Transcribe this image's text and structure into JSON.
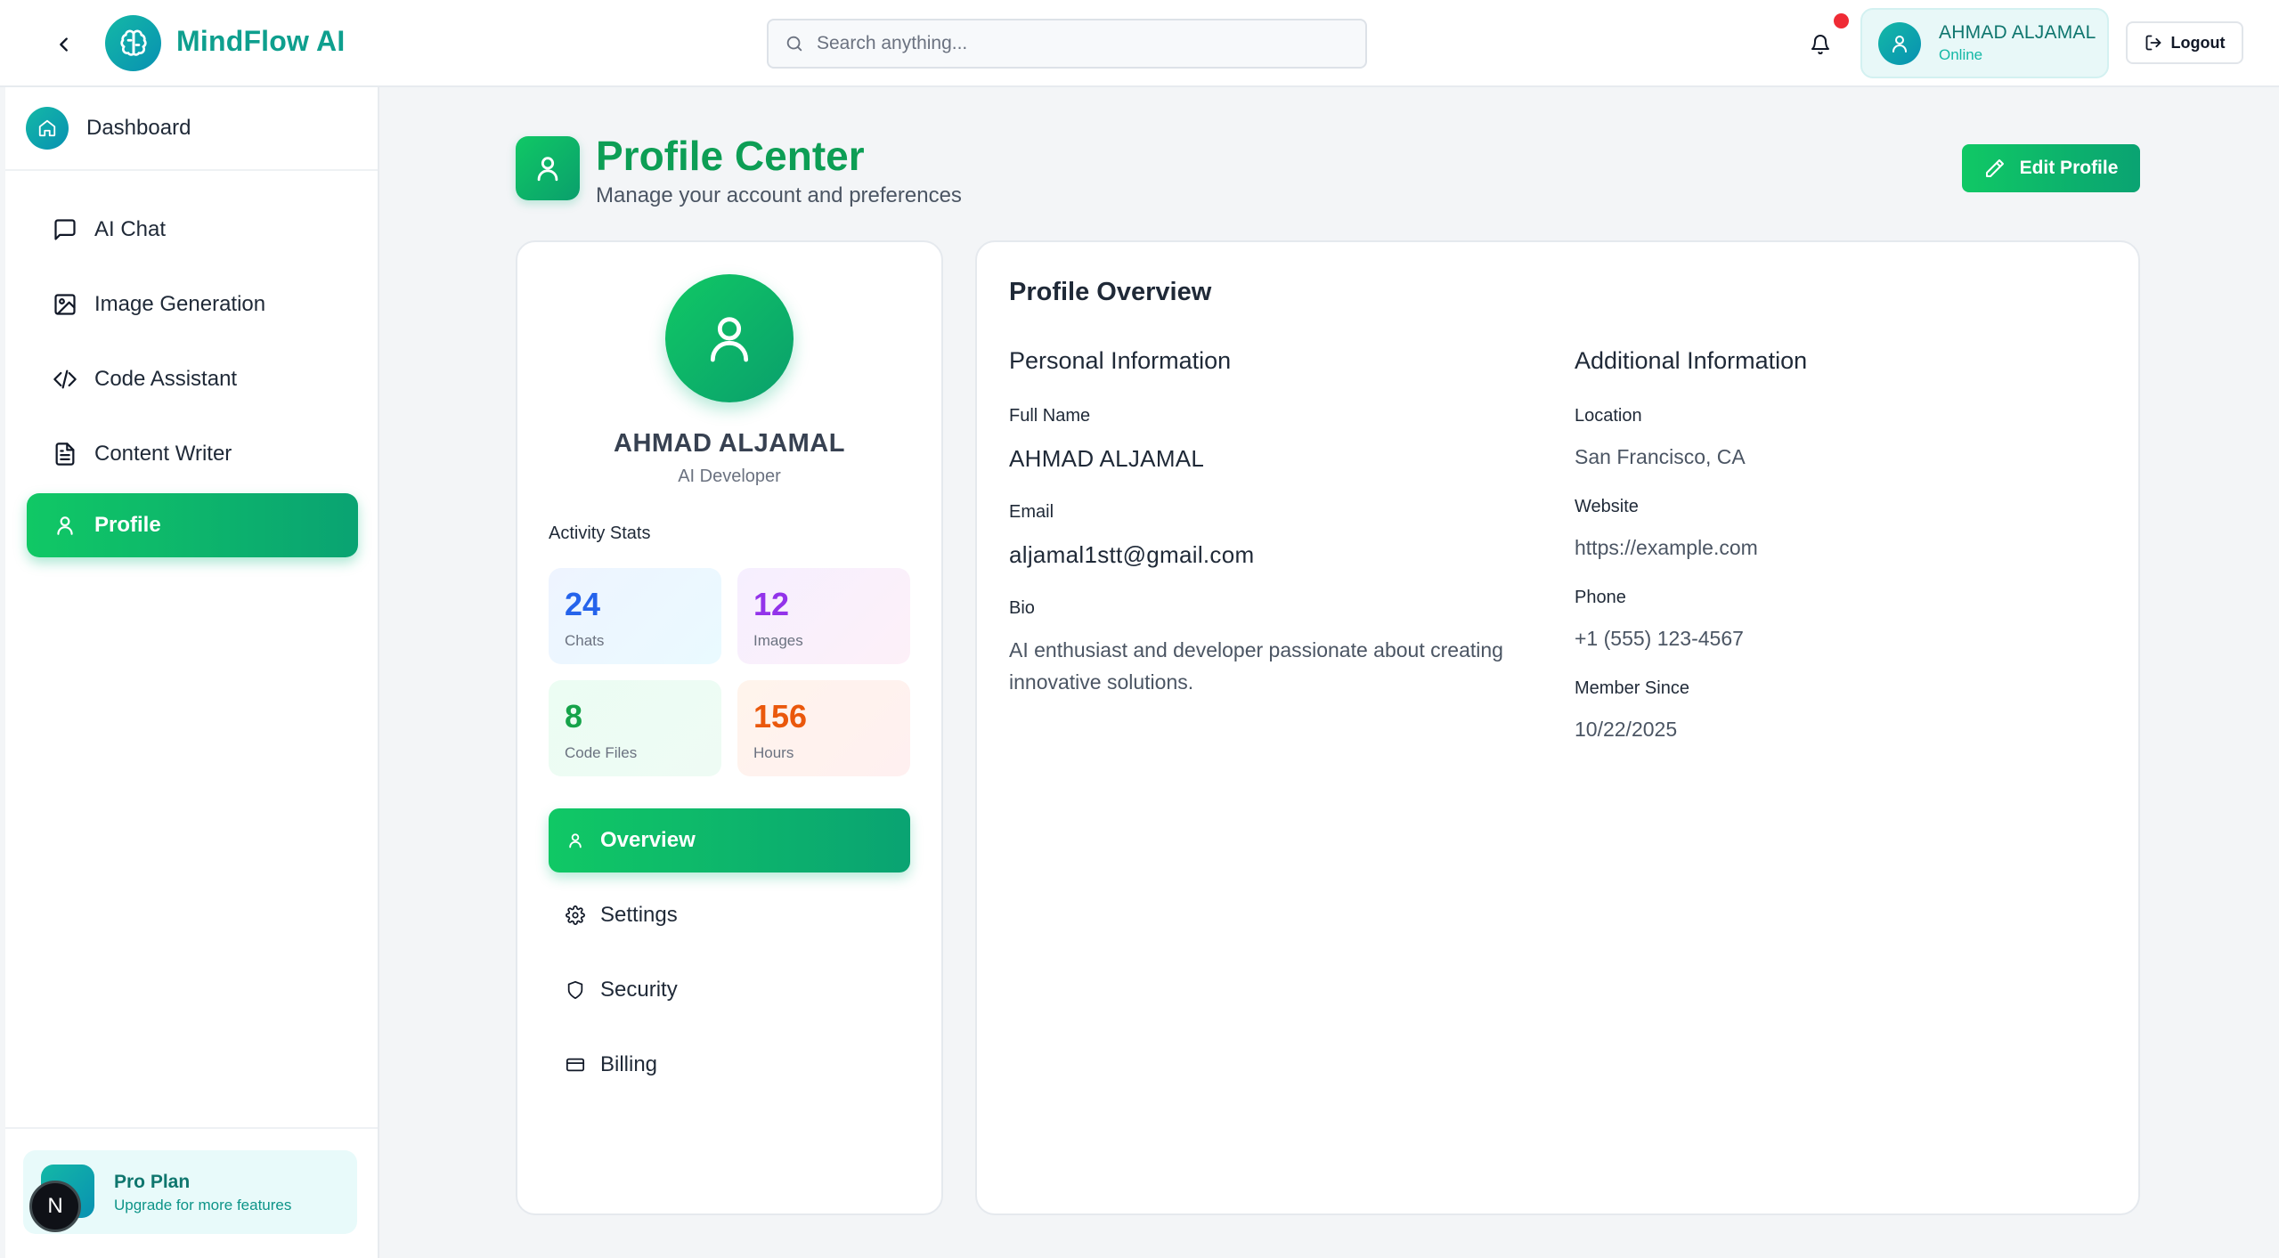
{
  "header": {
    "brand": "MindFlow AI",
    "search_placeholder": "Search anything...",
    "user": {
      "name": "AHMAD ALJAMAL",
      "status": "Online"
    },
    "logout_label": "Logout"
  },
  "sidebar": {
    "dashboard_label": "Dashboard",
    "items": [
      {
        "label": "AI Chat",
        "icon": "message-square-icon"
      },
      {
        "label": "Image Generation",
        "icon": "image-icon"
      },
      {
        "label": "Code Assistant",
        "icon": "code-icon"
      },
      {
        "label": "Content Writer",
        "icon": "file-text-icon"
      },
      {
        "label": "Profile",
        "icon": "user-icon",
        "active": true
      }
    ],
    "plan": {
      "title": "Pro Plan",
      "subtitle": "Upgrade for more features"
    },
    "dev_badge": "N"
  },
  "page": {
    "title": "Profile Center",
    "subtitle": "Manage your account and preferences",
    "edit_button": "Edit Profile"
  },
  "profile_card": {
    "name": "AHMAD ALJAMAL",
    "role": "AI Developer",
    "stats_title": "Activity Stats",
    "stats": [
      {
        "value": "24",
        "label": "Chats"
      },
      {
        "value": "12",
        "label": "Images"
      },
      {
        "value": "8",
        "label": "Code Files"
      },
      {
        "value": "156",
        "label": "Hours"
      }
    ],
    "nav": [
      {
        "label": "Overview",
        "icon": "user-icon",
        "active": true
      },
      {
        "label": "Settings",
        "icon": "gear-icon"
      },
      {
        "label": "Security",
        "icon": "shield-icon"
      },
      {
        "label": "Billing",
        "icon": "credit-card-icon"
      }
    ]
  },
  "overview": {
    "title": "Profile Overview",
    "personal": {
      "title": "Personal Information",
      "full_name_label": "Full Name",
      "full_name": "AHMAD ALJAMAL",
      "email_label": "Email",
      "email": "aljamal1stt@gmail.com",
      "bio_label": "Bio",
      "bio": "AI enthusiast and developer passionate about creating innovative solutions."
    },
    "additional": {
      "title": "Additional Information",
      "location_label": "Location",
      "location": "San Francisco, CA",
      "website_label": "Website",
      "website": "https://example.com",
      "phone_label": "Phone",
      "phone": "+1 (555) 123-4567",
      "member_since_label": "Member Since",
      "member_since": "10/22/2025"
    }
  },
  "colors": {
    "brand_teal": "#0e9f8e",
    "accent_green": "#10c865",
    "title_green": "#0d9e55",
    "notification_red": "#ef2b35"
  }
}
